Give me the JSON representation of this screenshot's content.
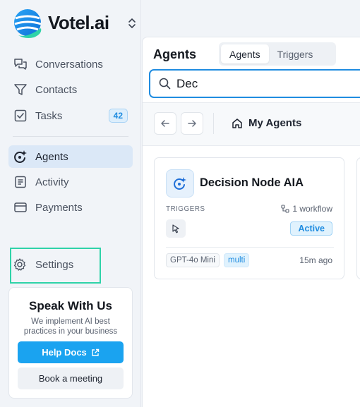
{
  "brand": {
    "name": "Votel.ai"
  },
  "sidebar": {
    "items": [
      {
        "label": "Conversations",
        "icon": "chat-bubbles-icon"
      },
      {
        "label": "Contacts",
        "icon": "filter-icon"
      },
      {
        "label": "Tasks",
        "icon": "checkbox-icon",
        "badge": "42"
      },
      {
        "label": "Agents",
        "icon": "agent-sparkle-icon",
        "active": true
      },
      {
        "label": "Activity",
        "icon": "document-list-icon"
      },
      {
        "label": "Payments",
        "icon": "credit-card-icon"
      }
    ],
    "settings_label": "Settings"
  },
  "promo": {
    "title": "Speak With Us",
    "subtitle": "We implement AI best practices in your business",
    "help_label": "Help Docs",
    "book_label": "Book a meeting"
  },
  "main": {
    "title": "Agents",
    "tabs": [
      {
        "label": "Agents",
        "active": true
      },
      {
        "label": "Triggers",
        "active": false
      }
    ],
    "search": {
      "value": "Dec",
      "placeholder": ""
    },
    "breadcrumb": "My Agents",
    "card": {
      "name": "Decision Node AIA",
      "triggers_label": "TRIGGERS",
      "workflow_label": "1 workflow",
      "status": "Active",
      "model": "GPT-4o Mini",
      "tag": "multi",
      "updated": "15m ago"
    }
  },
  "colors": {
    "accent": "#1aa3f0",
    "active_nav": "#dbe8f7",
    "highlight_box": "#2fd3a8",
    "status_blue": "#1f8ce0"
  }
}
